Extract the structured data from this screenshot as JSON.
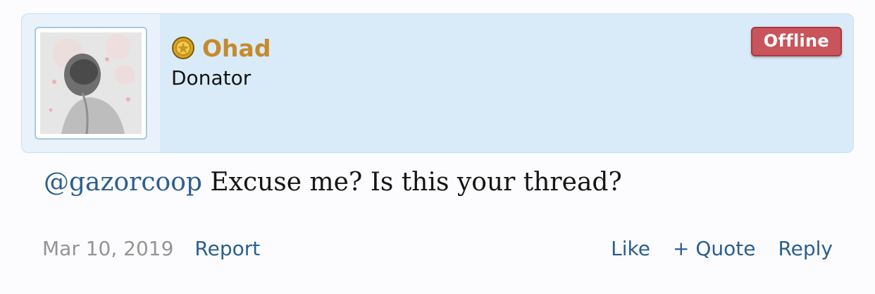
{
  "user": {
    "name": "Ohad",
    "title": "Donator",
    "status": "Offline",
    "avatar_icon": "avatar-image",
    "medal_icon": "gold-medal-icon"
  },
  "post": {
    "mention": "@gazorcoop",
    "text": " Excuse me? Is this your thread?"
  },
  "footer": {
    "date": "Mar 10, 2019",
    "report": "Report",
    "like": "Like",
    "quote": "+ Quote",
    "reply": "Reply"
  },
  "colors": {
    "username": "#c68a2c",
    "header_bg": "#d9ebf9",
    "link": "#2a5f8e",
    "status_badge": "#c9545b"
  }
}
